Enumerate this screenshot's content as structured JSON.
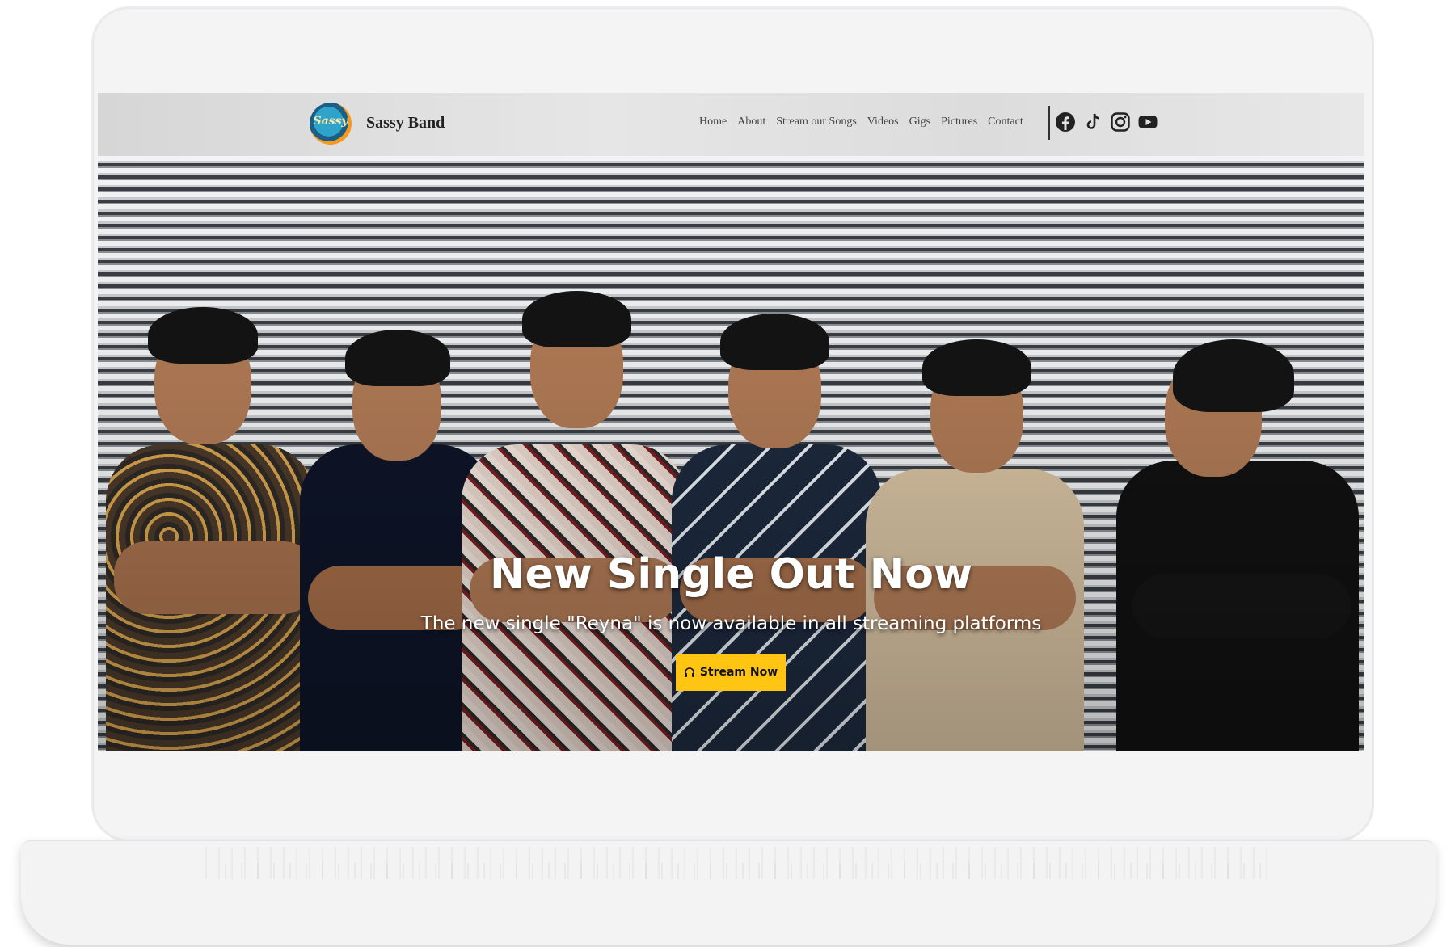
{
  "site": {
    "brand": "Sassy Band",
    "logo_text": "Sassy"
  },
  "nav": {
    "items": [
      "Home",
      "About",
      "Stream our Songs",
      "Videos",
      "Gigs",
      "Pictures",
      "Contact"
    ]
  },
  "social": {
    "icons": [
      "facebook-icon",
      "tiktok-icon",
      "instagram-icon",
      "youtube-icon"
    ]
  },
  "hero": {
    "title": "New Single Out Now",
    "subtitle": "The new single \"Reyna\" is now available in all streaming platforms",
    "cta_label": "Stream Now",
    "cta_icon": "headphones-icon",
    "accent_color": "#ffc512"
  }
}
